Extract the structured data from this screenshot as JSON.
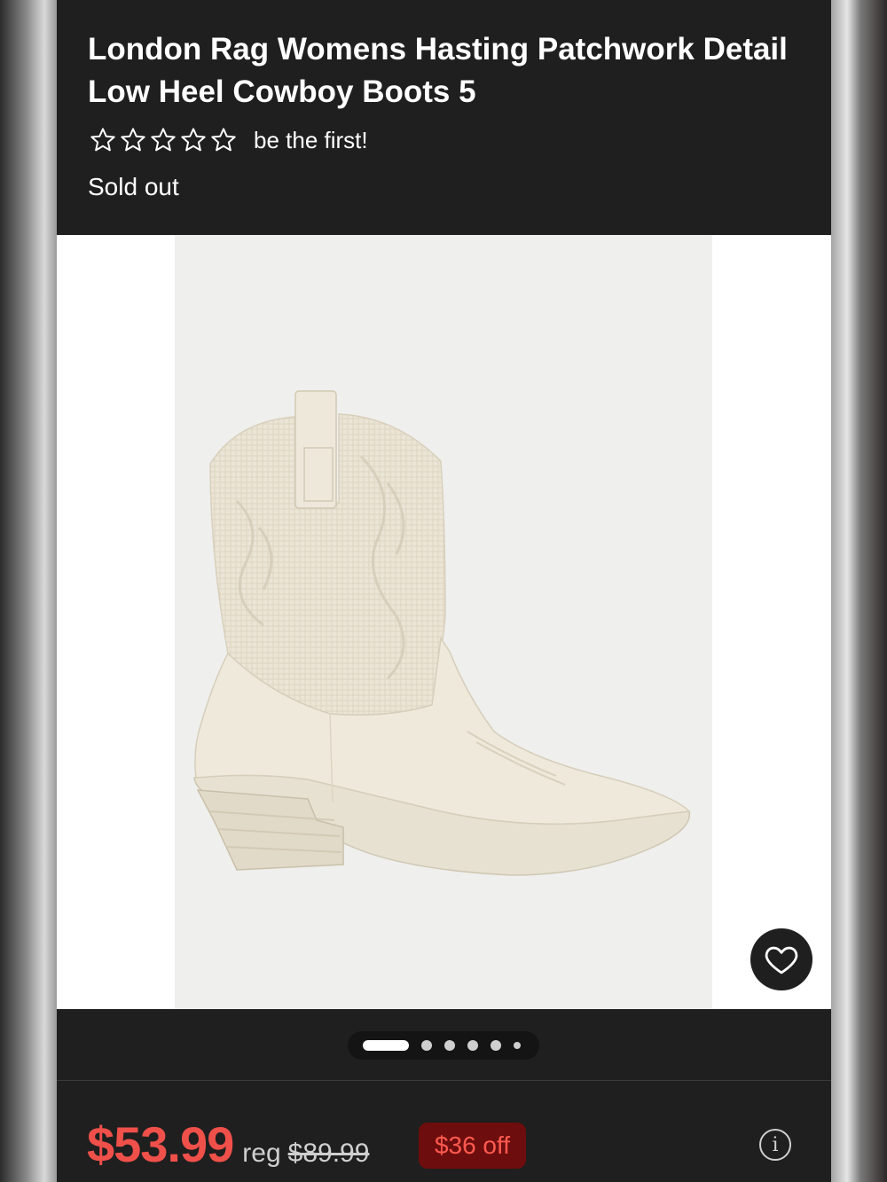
{
  "product": {
    "title": "London Rag Womens Hasting Patchwork Detail Low Heel Cowboy Boots 5",
    "rating": {
      "stars": 0,
      "max": 5,
      "text": "be the first!"
    },
    "availability": "Sold out"
  },
  "gallery": {
    "image_count": 6,
    "active_index": 0,
    "icons": {
      "favorite": "heart-icon"
    }
  },
  "pricing": {
    "price": "$53.99",
    "reg_label": "reg",
    "reg_price": "$89.99",
    "discount": "$36 off",
    "info_icon": "info-icon",
    "info_glyph": "i"
  },
  "colors": {
    "price": "#f0504a",
    "discount_bg": "#6e0d0d",
    "panel": "#1f1f1f"
  }
}
